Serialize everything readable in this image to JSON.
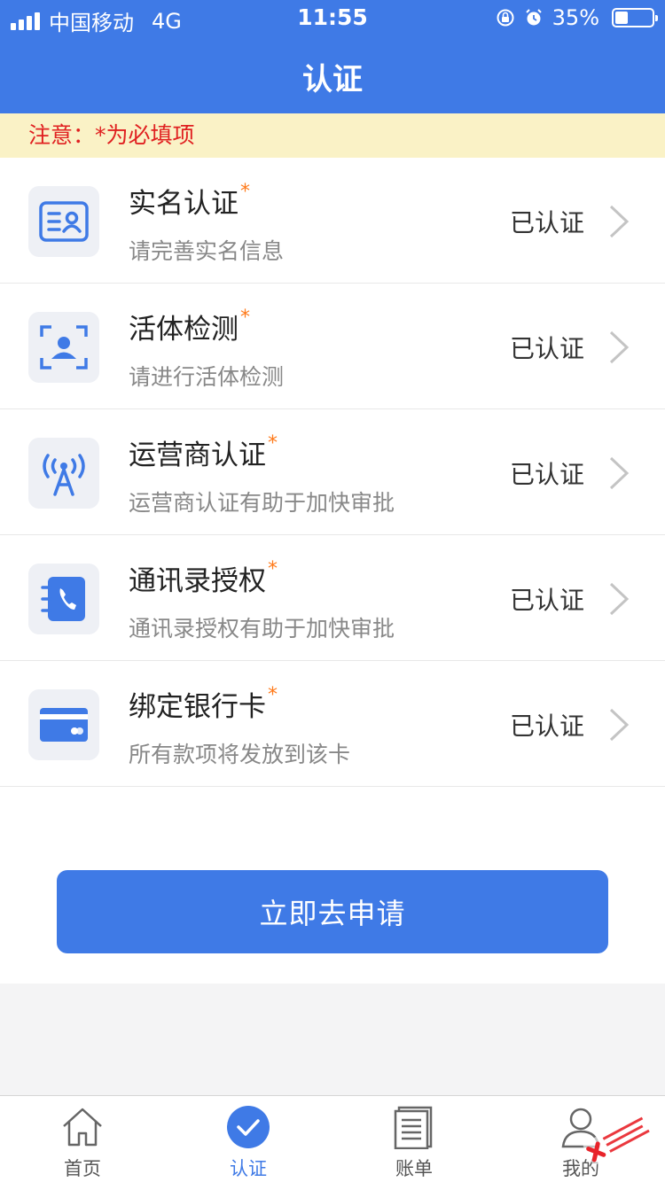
{
  "status_bar": {
    "carrier": "中国移动",
    "network": "4G",
    "time": "11:55",
    "battery_percent": "35%",
    "battery_level": 0.35
  },
  "header": {
    "title": "认证"
  },
  "notice": {
    "text": "注意：*为必填项"
  },
  "items": [
    {
      "title": "实名认证",
      "required": "*",
      "subtitle": "请完善实名信息",
      "status": "已认证",
      "icon": "id-card-icon"
    },
    {
      "title": "活体检测",
      "required": "*",
      "subtitle": "请进行活体检测",
      "status": "已认证",
      "icon": "face-scan-icon"
    },
    {
      "title": "运营商认证",
      "required": "*",
      "subtitle": "运营商认证有助于加快审批",
      "status": "已认证",
      "icon": "signal-tower-icon"
    },
    {
      "title": "通讯录授权",
      "required": "*",
      "subtitle": "通讯录授权有助于加快审批",
      "status": "已认证",
      "icon": "contacts-phone-icon"
    },
    {
      "title": "绑定银行卡",
      "required": "*",
      "subtitle": "所有款项将发放到该卡",
      "status": "已认证",
      "icon": "bank-card-icon"
    }
  ],
  "apply_button": {
    "label": "立即去申请"
  },
  "tabbar": {
    "tabs": [
      {
        "label": "首页",
        "icon": "home-icon",
        "active": false
      },
      {
        "label": "认证",
        "icon": "check-circle-icon",
        "active": true
      },
      {
        "label": "账单",
        "icon": "bill-icon",
        "active": false
      },
      {
        "label": "我的",
        "icon": "user-icon",
        "active": false
      }
    ]
  },
  "colors": {
    "primary": "#3f7ae6",
    "notice_bg": "#faf2c6",
    "notice_text": "#e02020",
    "required": "#ff7a1a"
  }
}
